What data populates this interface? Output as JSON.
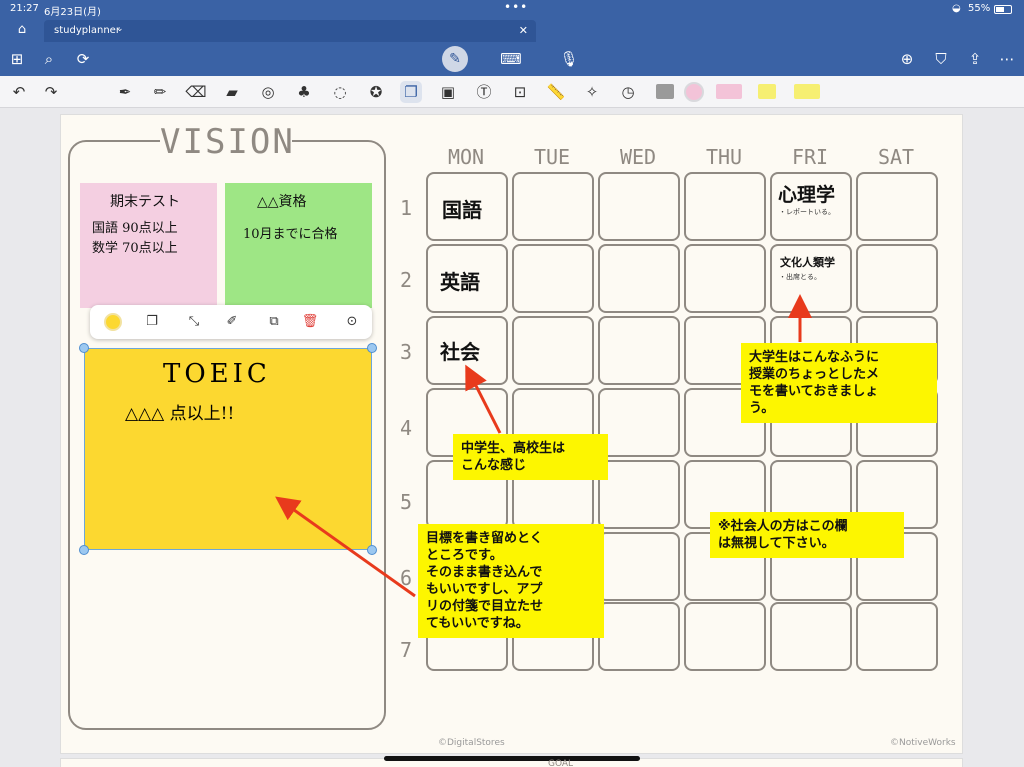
{
  "status": {
    "time": "21:27",
    "date": "6月23日(月)",
    "battery": "55%"
  },
  "tab": {
    "title": "studyplanner"
  },
  "toolbar": {
    "icons": [
      "grid-icon",
      "search-icon",
      "lasso-icon",
      "pen-mode-icon",
      "keyboard-icon",
      "mic-icon",
      "add-page-icon",
      "bookmark-icon",
      "share-icon",
      "more-icon"
    ]
  },
  "tools": {
    "icons": [
      "undo-icon",
      "redo-icon",
      "pen-icon",
      "pencil-icon",
      "eraser-icon",
      "highlighter-icon",
      "shape-icon",
      "elements-icon",
      "lasso-tool-icon",
      "star-icon",
      "sticky-note-icon",
      "image-icon",
      "text-icon",
      "scan-icon",
      "ruler-icon",
      "laser-icon",
      "clock-icon"
    ],
    "swatches": [
      "#cfcfcf",
      "#f3c3d8",
      "#f6ef72",
      "#f6ef72"
    ]
  },
  "vision": {
    "title": "VISION",
    "pink_note": {
      "line1": "期末テスト",
      "line2": "国語 90点以上",
      "line3": "数学 70点以上"
    },
    "green_note": {
      "line1": "△△資格",
      "line2": "10月までに合格"
    },
    "yellow_note": {
      "line1": "TOEIC",
      "line2": "△△△ 点以上!!"
    },
    "context_menu_icons": [
      "color-dot-icon",
      "note-style-icon",
      "collapse-icon",
      "edit-icon",
      "copy-icon",
      "delete-icon",
      "more-options-icon"
    ]
  },
  "calendar": {
    "days": [
      "MON",
      "TUE",
      "WED",
      "THU",
      "FRI",
      "SAT"
    ],
    "periods": [
      "1",
      "2",
      "3",
      "4",
      "5",
      "6",
      "7"
    ],
    "mon": [
      "国語",
      "英語",
      "社会"
    ],
    "fri1_title": "心理学",
    "fri1_sub": "・レポートいる。",
    "fri2_title": "文化人類学",
    "fri2_sub": "・出席とる。"
  },
  "callouts": {
    "university": [
      "大学生はこんなふうに",
      "授業のちょっとしたメ",
      "モを書いておきましょ",
      "う。"
    ],
    "middle_high": [
      "中学生、高校生は",
      "こんな感じ"
    ],
    "worker": [
      "※社会人の方はこの欄",
      "は無視して下さい。"
    ],
    "goals": [
      "目標を書き留めとく",
      "ところです。",
      "そのまま書き込んで",
      "もいいですし、アプ",
      "リの付箋で目立たせ",
      "てもいいですね。"
    ]
  },
  "footer": {
    "left": "©DigitalStores",
    "right": "©NotiveWorks",
    "next_page_text": "GOAL"
  }
}
